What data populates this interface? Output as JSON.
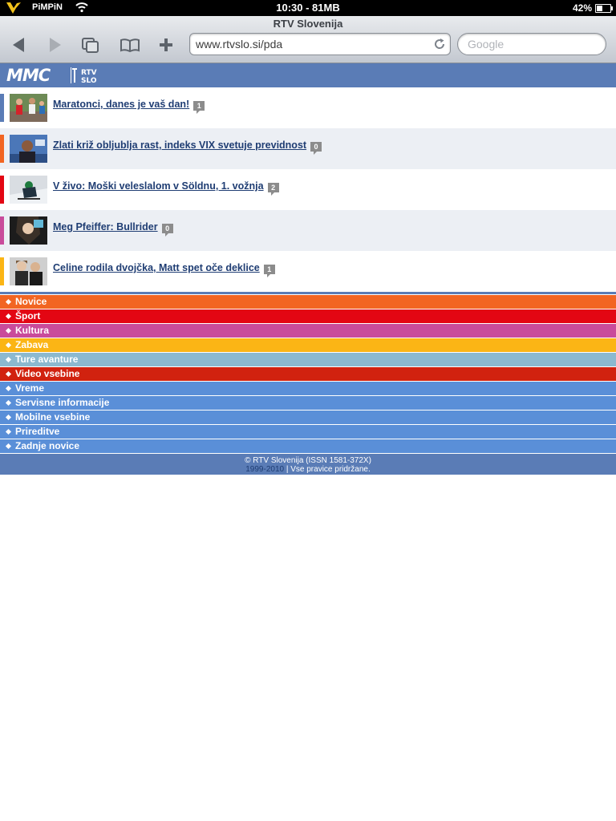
{
  "status_bar": {
    "carrier": "PiMPiN",
    "clock": "10:30 - 81MB",
    "battery_percent": "42%",
    "battery_level": 0.42
  },
  "browser": {
    "page_title": "RTV Slovenija",
    "url": "www.rtvslo.si/pda",
    "search_placeholder": "Google"
  },
  "site": {
    "logo_text": "MMC",
    "rtv_logo_lines": [
      "RTV",
      "SLO"
    ]
  },
  "articles": [
    {
      "title": "Maratonci, danes je vaš dan!",
      "comments": "1",
      "accent": "#5a7cb6",
      "thumb": "runners"
    },
    {
      "title": "Zlati križ obljublja rast, indeks VIX svetuje previdnost",
      "comments": "0",
      "accent": "#f26522",
      "thumb": "speaker"
    },
    {
      "title": "V živo: Moški veleslalom v Söldnu, 1. vožnja",
      "comments": "2",
      "accent": "#e30613",
      "thumb": "skier"
    },
    {
      "title": "Meg Pfeiffer: Bullrider",
      "comments": "0",
      "accent": "#c94b9b",
      "thumb": "portrait"
    },
    {
      "title": "Celine rodila dvojčka, Matt spet oče deklice",
      "comments": "1",
      "accent": "#fbb515",
      "thumb": "couple"
    }
  ],
  "nav": [
    {
      "label": "Novice",
      "color": "#f26522"
    },
    {
      "label": "Šport",
      "color": "#e30613"
    },
    {
      "label": "Kultura",
      "color": "#c94b9b"
    },
    {
      "label": "Zabava",
      "color": "#fbb515"
    },
    {
      "label": "Ture avanture",
      "color": "#8cb9cf"
    },
    {
      "label": "Video vsebine",
      "color": "#d1220f"
    },
    {
      "label": "Vreme",
      "color": "#5a8fd8"
    },
    {
      "label": "Servisne informacije",
      "color": "#5a8fd8"
    },
    {
      "label": "Mobilne vsebine",
      "color": "#5a8fd8"
    },
    {
      "label": "Prireditve",
      "color": "#5a8fd8"
    },
    {
      "label": "Zadnje novice",
      "color": "#5a8fd8"
    }
  ],
  "footer": {
    "copyright": "© RTV Slovenija (ISSN 1581-372X)",
    "years": "1999-2010",
    "rights": " | Vse pravice pridržane."
  }
}
